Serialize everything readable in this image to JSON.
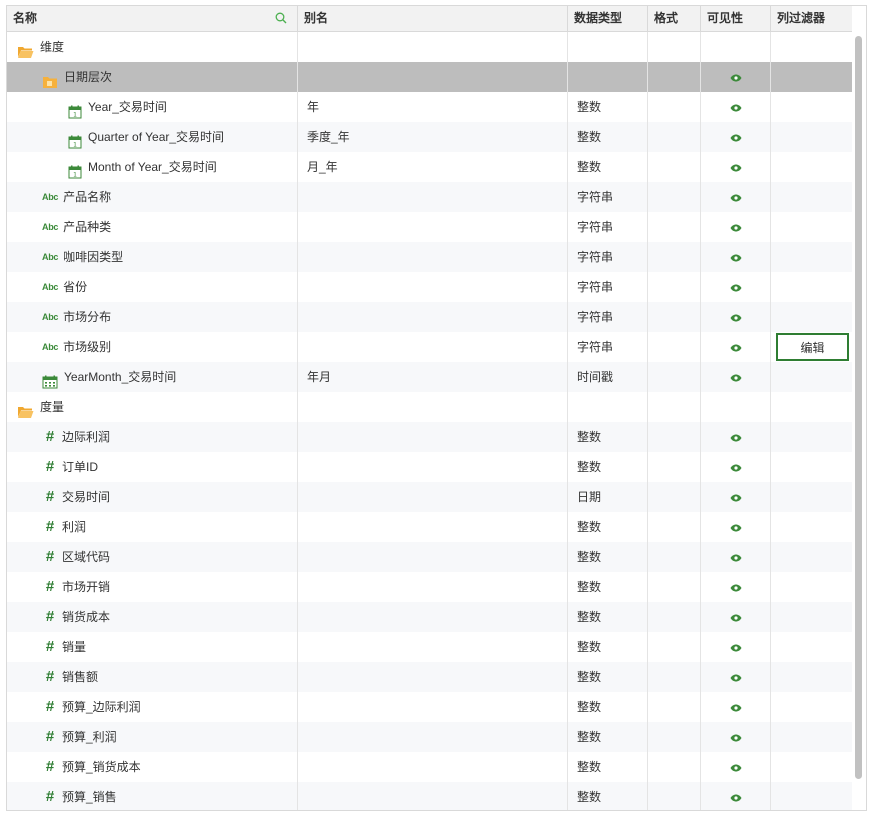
{
  "header": {
    "name": "名称",
    "alias": "别名",
    "data_type": "数据类型",
    "format": "格式",
    "visibility": "可见性",
    "column_filter": "列过滤器"
  },
  "edit_label": "编辑",
  "colors": {
    "accent": "#2e7d32",
    "folder": "#f6b13c",
    "selected_row": "#bdbdbd"
  },
  "rows": [
    {
      "name": "维度",
      "alias": "",
      "type": "",
      "visible": false,
      "icon": "folder-open-icon"
    },
    {
      "name": "日期层次",
      "alias": "",
      "type": "",
      "visible": true,
      "icon": "folder-icon"
    },
    {
      "name": "Year_交易时间",
      "alias": "年",
      "type": "整数",
      "visible": true,
      "icon": "calendar-icon"
    },
    {
      "name": "Quarter of Year_交易时间",
      "alias": "季度_年",
      "type": "整数",
      "visible": true,
      "icon": "calendar-icon"
    },
    {
      "name": "Month of Year_交易时间",
      "alias": "月_年",
      "type": "整数",
      "visible": true,
      "icon": "calendar-icon"
    },
    {
      "name": "产品名称",
      "alias": "",
      "type": "字符串",
      "visible": true,
      "icon": "abc-icon"
    },
    {
      "name": "产品种类",
      "alias": "",
      "type": "字符串",
      "visible": true,
      "icon": "abc-icon"
    },
    {
      "name": "咖啡因类型",
      "alias": "",
      "type": "字符串",
      "visible": true,
      "icon": "abc-icon"
    },
    {
      "name": "省份",
      "alias": "",
      "type": "字符串",
      "visible": true,
      "icon": "abc-icon"
    },
    {
      "name": "市场分布",
      "alias": "",
      "type": "字符串",
      "visible": true,
      "icon": "abc-icon"
    },
    {
      "name": "市场级别",
      "alias": "",
      "type": "字符串",
      "visible": true,
      "icon": "abc-icon",
      "editable": true
    },
    {
      "name": "YearMonth_交易时间",
      "alias": "年月",
      "type": "时间戳",
      "visible": true,
      "icon": "timestamp-icon"
    },
    {
      "name": "度量",
      "alias": "",
      "type": "",
      "visible": false,
      "icon": "folder-open-icon"
    },
    {
      "name": "边际利润",
      "alias": "",
      "type": "整数",
      "visible": true,
      "icon": "hash-icon"
    },
    {
      "name": "订单ID",
      "alias": "",
      "type": "整数",
      "visible": true,
      "icon": "hash-icon"
    },
    {
      "name": "交易时间",
      "alias": "",
      "type": "日期",
      "visible": true,
      "icon": "hash-icon"
    },
    {
      "name": "利润",
      "alias": "",
      "type": "整数",
      "visible": true,
      "icon": "hash-icon"
    },
    {
      "name": "区域代码",
      "alias": "",
      "type": "整数",
      "visible": true,
      "icon": "hash-icon"
    },
    {
      "name": "市场开销",
      "alias": "",
      "type": "整数",
      "visible": true,
      "icon": "hash-icon"
    },
    {
      "name": "销货成本",
      "alias": "",
      "type": "整数",
      "visible": true,
      "icon": "hash-icon"
    },
    {
      "name": "销量",
      "alias": "",
      "type": "整数",
      "visible": true,
      "icon": "hash-icon"
    },
    {
      "name": "销售额",
      "alias": "",
      "type": "整数",
      "visible": true,
      "icon": "hash-icon"
    },
    {
      "name": "预算_边际利润",
      "alias": "",
      "type": "整数",
      "visible": true,
      "icon": "hash-icon"
    },
    {
      "name": "预算_利润",
      "alias": "",
      "type": "整数",
      "visible": true,
      "icon": "hash-icon"
    },
    {
      "name": "预算_销货成本",
      "alias": "",
      "type": "整数",
      "visible": true,
      "icon": "hash-icon"
    },
    {
      "name": "预算_销售",
      "alias": "",
      "type": "整数",
      "visible": true,
      "icon": "hash-icon"
    }
  ]
}
